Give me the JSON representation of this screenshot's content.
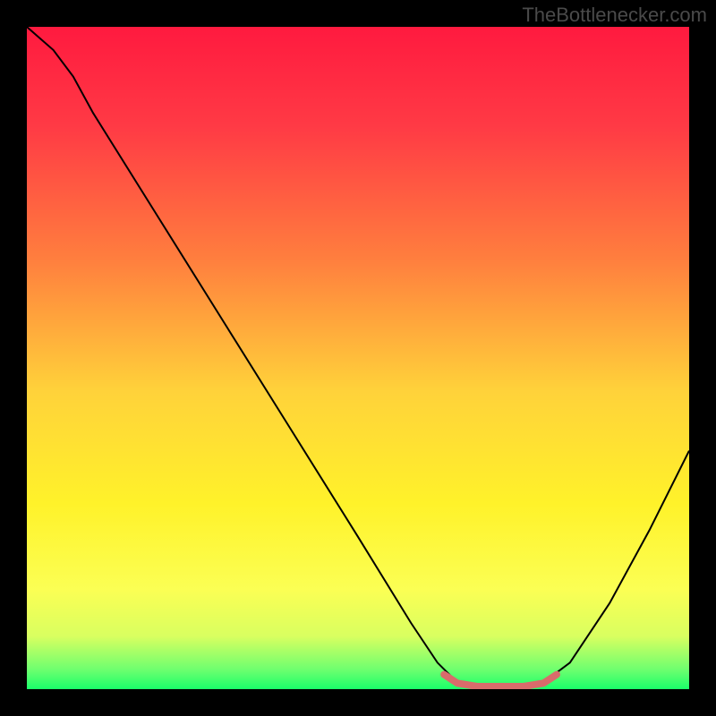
{
  "watermark": "TheBottlenecker.com",
  "chart_data": {
    "type": "line",
    "title": "",
    "xlabel": "",
    "ylabel": "",
    "xlim": [
      0,
      100
    ],
    "ylim": [
      0,
      100
    ],
    "grid": false,
    "gradient_stops": [
      {
        "offset": 0,
        "color": "#ff1a3f"
      },
      {
        "offset": 15,
        "color": "#ff3a45"
      },
      {
        "offset": 35,
        "color": "#ff7e3e"
      },
      {
        "offset": 55,
        "color": "#ffd23a"
      },
      {
        "offset": 72,
        "color": "#fff22a"
      },
      {
        "offset": 85,
        "color": "#fbff54"
      },
      {
        "offset": 92,
        "color": "#d9ff60"
      },
      {
        "offset": 97,
        "color": "#6fff6f"
      },
      {
        "offset": 100,
        "color": "#1aff6a"
      }
    ],
    "series": [
      {
        "name": "bottleneck-curve",
        "stroke": "#000000",
        "points": [
          {
            "x": 0.0,
            "y": 100.0
          },
          {
            "x": 4.0,
            "y": 96.5
          },
          {
            "x": 7.0,
            "y": 92.5
          },
          {
            "x": 10.0,
            "y": 87.0
          },
          {
            "x": 20.0,
            "y": 71.0
          },
          {
            "x": 30.0,
            "y": 55.0
          },
          {
            "x": 40.0,
            "y": 39.0
          },
          {
            "x": 50.0,
            "y": 23.0
          },
          {
            "x": 58.0,
            "y": 10.0
          },
          {
            "x": 62.0,
            "y": 4.0
          },
          {
            "x": 65.0,
            "y": 1.0
          },
          {
            "x": 68.0,
            "y": 0.2
          },
          {
            "x": 74.0,
            "y": 0.2
          },
          {
            "x": 78.0,
            "y": 1.0
          },
          {
            "x": 82.0,
            "y": 4.0
          },
          {
            "x": 88.0,
            "y": 13.0
          },
          {
            "x": 94.0,
            "y": 24.0
          },
          {
            "x": 100.0,
            "y": 36.0
          }
        ]
      },
      {
        "name": "optimal-zone",
        "stroke": "#d96b6b",
        "points": [
          {
            "x": 63.0,
            "y": 2.2
          },
          {
            "x": 65.0,
            "y": 0.9
          },
          {
            "x": 68.0,
            "y": 0.4
          },
          {
            "x": 72.0,
            "y": 0.4
          },
          {
            "x": 75.0,
            "y": 0.4
          },
          {
            "x": 78.0,
            "y": 0.9
          },
          {
            "x": 80.0,
            "y": 2.2
          }
        ]
      }
    ]
  }
}
